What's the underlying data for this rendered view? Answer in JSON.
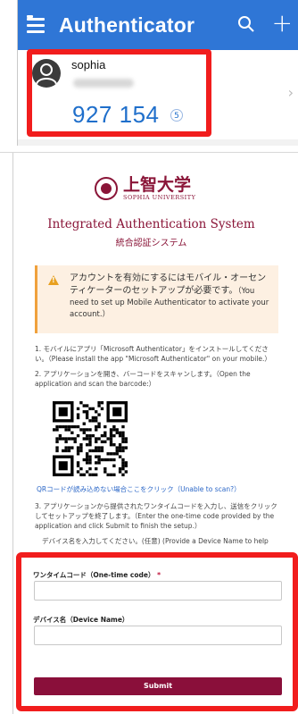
{
  "app": {
    "title": "Authenticator",
    "account": {
      "name": "sophia",
      "code": "927 154",
      "seconds_remaining": "5"
    }
  },
  "setup_page": {
    "logo_jp": "上智大学",
    "logo_en": "SOPHIA UNIVERSITY",
    "title": "Integrated Authentication System",
    "subtitle": "統合認証システム",
    "warning_big": "アカウントを有効にするにはモバイル・オーセンティケーターのセットアップが必要です。",
    "warning_small": "（You need to set up Mobile Authenticator to activate your account.）",
    "step1": "1. モバイルにアプリ「Microsoft Authenticator」をインストールしてください。（Please install the app \"Microsoft Authenticator\" on your mobile.）",
    "step2": "2. アプリケーションを開き、バーコードをスキャンします。（Open the application and scan the barcode:）",
    "qr_link": "QRコードが読み込めない場合ここをクリック（Unable to scan?）",
    "step3": "3. アプリケーションから提供されたワンタイムコードを入力し、送信をクリックしてセットアップを終了します。（Enter the one-time code provided by the application and click Submit to finish the setup.）",
    "device_hint": "デバイス名を入力してください。(任意) (Provide a Device Name to help"
  },
  "form": {
    "otp_label": "ワンタイムコード（One-time code）",
    "required_mark": "*",
    "device_label": "デバイス名（Device Name）",
    "submit_label": "Submit"
  },
  "colors": {
    "appbar": "#2f76d6",
    "brand": "#8a1538",
    "highlight": "#f11d1d"
  }
}
